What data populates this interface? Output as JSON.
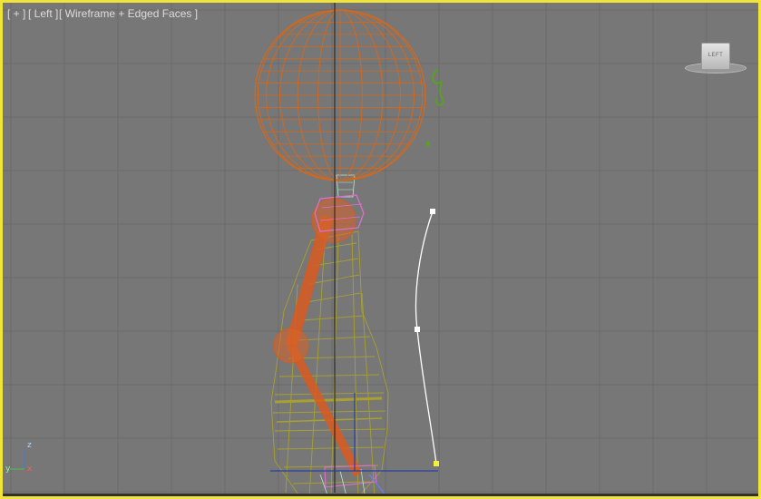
{
  "viewport": {
    "label_plus": "[ + ]",
    "label_view": "[ Left ]",
    "label_shading": "[ Wireframe + Edged Faces ]",
    "viewcube_face": "LEFT",
    "axis": {
      "z": "z",
      "y": "y",
      "x": "x"
    }
  },
  "colors": {
    "background": "#777777",
    "grid": "#6b6b6b",
    "active_border": "#f0e33a",
    "head_wire": "#d2691e",
    "body_wire": "#a8a030",
    "bone": "#d85a20",
    "gizmo": "#2a3fa0",
    "spline": "#ffffff",
    "pink_controls": "#e070d0",
    "green_detail": "#5aa020"
  },
  "icons": [
    "viewcube-icon",
    "axis-tripod-icon"
  ]
}
